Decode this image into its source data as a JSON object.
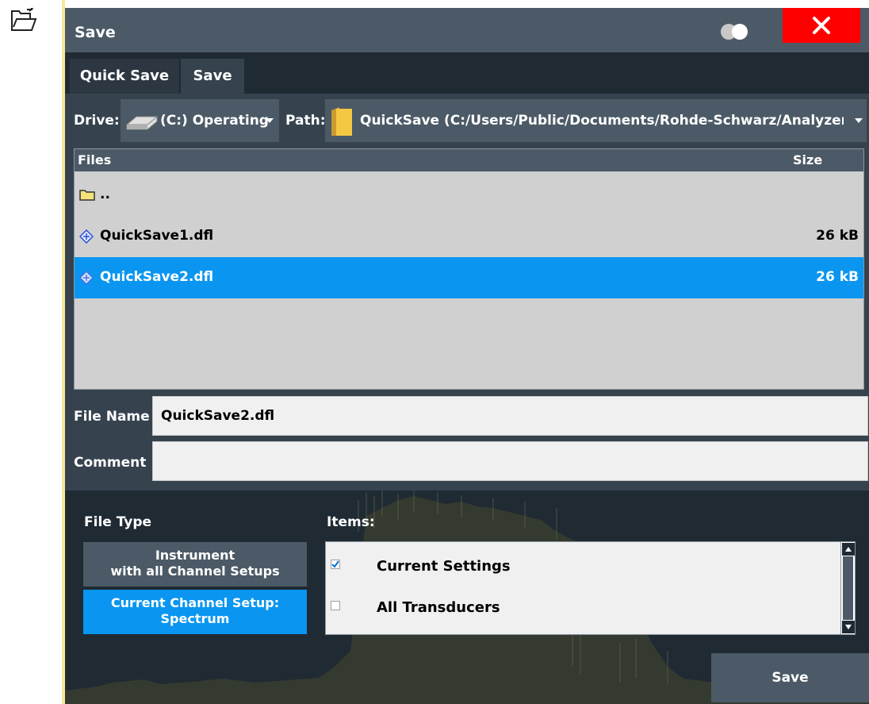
{
  "dialog": {
    "title": "Save"
  },
  "tabs": [
    {
      "label": "Quick Save"
    },
    {
      "label": "Save"
    }
  ],
  "drive": {
    "label": "Drive:",
    "value": "(C:) Operating"
  },
  "path": {
    "label": "Path:",
    "value": "QuickSave (C:/Users/Public/Documents/Rohde-Schwarz/Analyzer/("
  },
  "files": {
    "header_files": "Files",
    "header_size": "Size",
    "rows": [
      {
        "name": "..",
        "size": "",
        "icon": "folder-icon"
      },
      {
        "name": "QuickSave1.dfl",
        "size": "26 kB",
        "icon": "file-icon"
      },
      {
        "name": "QuickSave2.dfl",
        "size": "26 kB",
        "icon": "file-icon",
        "selected": true
      }
    ]
  },
  "file_name": {
    "label": "File Name",
    "value": "QuickSave2.dfl"
  },
  "comment": {
    "label": "Comment",
    "value": ""
  },
  "file_type": {
    "label": "File Type",
    "instrument_line1": "Instrument",
    "instrument_line2": "with all Channel Setups",
    "channel_line1": "Current Channel Setup:",
    "channel_line2": "Spectrum"
  },
  "items": {
    "label": "Items:",
    "list": [
      {
        "label": "Current Settings",
        "checked": true
      },
      {
        "label": "All Transducers",
        "checked": false
      }
    ]
  },
  "save_button": {
    "label": "Save"
  },
  "colors": {
    "accent": "#0a96f0",
    "close": "#ff0000",
    "panel": "#36434f",
    "titlebar": "#4b5a66"
  }
}
